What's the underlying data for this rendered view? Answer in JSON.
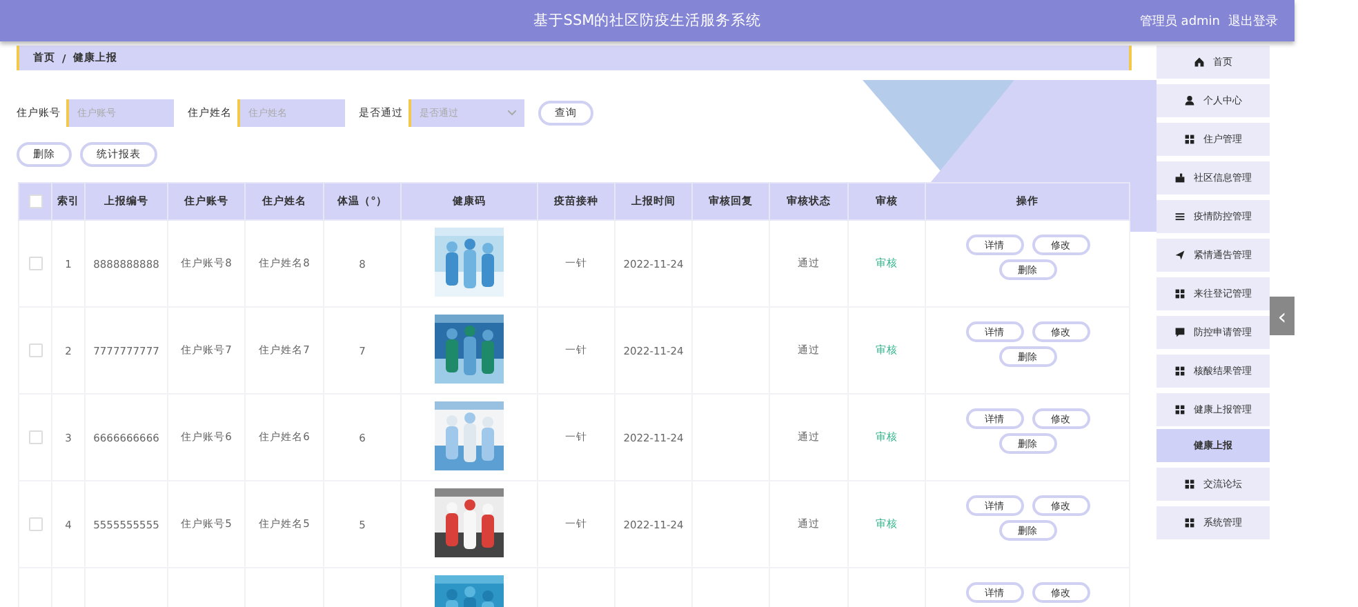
{
  "header": {
    "title": "基于SSM的社区防疫生活服务系统",
    "user": "管理员 admin",
    "logout": "退出登录"
  },
  "breadcrumb": [
    "首页",
    "/",
    "健康上报"
  ],
  "search": {
    "fields": [
      {
        "label": "住户账号",
        "placeholder": "住户账号",
        "kind": "text"
      },
      {
        "label": "住户姓名",
        "placeholder": "住户姓名",
        "kind": "text"
      },
      {
        "label": "是否通过",
        "placeholder": "是否通过",
        "kind": "select"
      }
    ],
    "button": "查询"
  },
  "actions": [
    "删除",
    "统计报表"
  ],
  "table": {
    "select_all": {
      "checked": false
    },
    "columns": [
      "索引",
      "上报编号",
      "住户账号",
      "住户姓名",
      "体温（°）",
      "健康码",
      "疫苗接种",
      "上报时间",
      "审核回复",
      "审核状态",
      "审核",
      "操作"
    ],
    "rows": [
      {
        "checked": false,
        "index": "1",
        "report_no": "8888888888",
        "account": "住户账号8",
        "name": "住户姓名8",
        "temperature": "8",
        "vaccine": "一针",
        "time": "2022-11-24",
        "status": "通过",
        "review": "审核",
        "ops": [
          "详情",
          "修改",
          "删除"
        ]
      },
      {
        "checked": false,
        "index": "2",
        "report_no": "7777777777",
        "account": "住户账号7",
        "name": "住户姓名7",
        "temperature": "7",
        "vaccine": "一针",
        "time": "2022-11-24",
        "status": "通过",
        "review": "审核",
        "ops": [
          "详情",
          "修改",
          "删除"
        ]
      },
      {
        "checked": false,
        "index": "3",
        "report_no": "6666666666",
        "account": "住户账号6",
        "name": "住户姓名6",
        "temperature": "6",
        "vaccine": "一针",
        "time": "2022-11-24",
        "status": "通过",
        "review": "审核",
        "ops": [
          "详情",
          "修改",
          "删除"
        ]
      },
      {
        "checked": false,
        "index": "4",
        "report_no": "5555555555",
        "account": "住户账号5",
        "name": "住户姓名5",
        "temperature": "5",
        "vaccine": "一针",
        "time": "2022-11-24",
        "status": "通过",
        "review": "审核",
        "ops": [
          "详情",
          "修改",
          "删除"
        ]
      },
      {
        "ops": [
          "详情",
          "修改"
        ]
      }
    ]
  },
  "sidebar": {
    "items": [
      {
        "label": "首页",
        "kind": "home",
        "selected": false
      },
      {
        "label": "个人中心",
        "kind": "user",
        "selected": false
      },
      {
        "label": "住户管理",
        "kind": "grid",
        "selected": false
      },
      {
        "label": "社区信息管理",
        "kind": "case",
        "selected": false
      },
      {
        "label": "疫情防控管理",
        "kind": "list",
        "selected": false
      },
      {
        "label": "紧情通告管理",
        "kind": "plane",
        "selected": false
      },
      {
        "label": "来往登记管理",
        "kind": "grid",
        "selected": false
      },
      {
        "label": "防控申请管理",
        "kind": "chat",
        "selected": false
      },
      {
        "label": "核酸结果管理",
        "kind": "grid",
        "selected": false
      },
      {
        "label": "健康上报管理",
        "kind": "grid",
        "selected": false,
        "children": [
          {
            "label": "健康上报",
            "selected": true
          }
        ]
      },
      {
        "label": "交流论坛",
        "kind": "grid",
        "selected": false
      },
      {
        "label": "系统管理",
        "kind": "grid",
        "selected": false
      }
    ],
    "collapse": "‹"
  }
}
